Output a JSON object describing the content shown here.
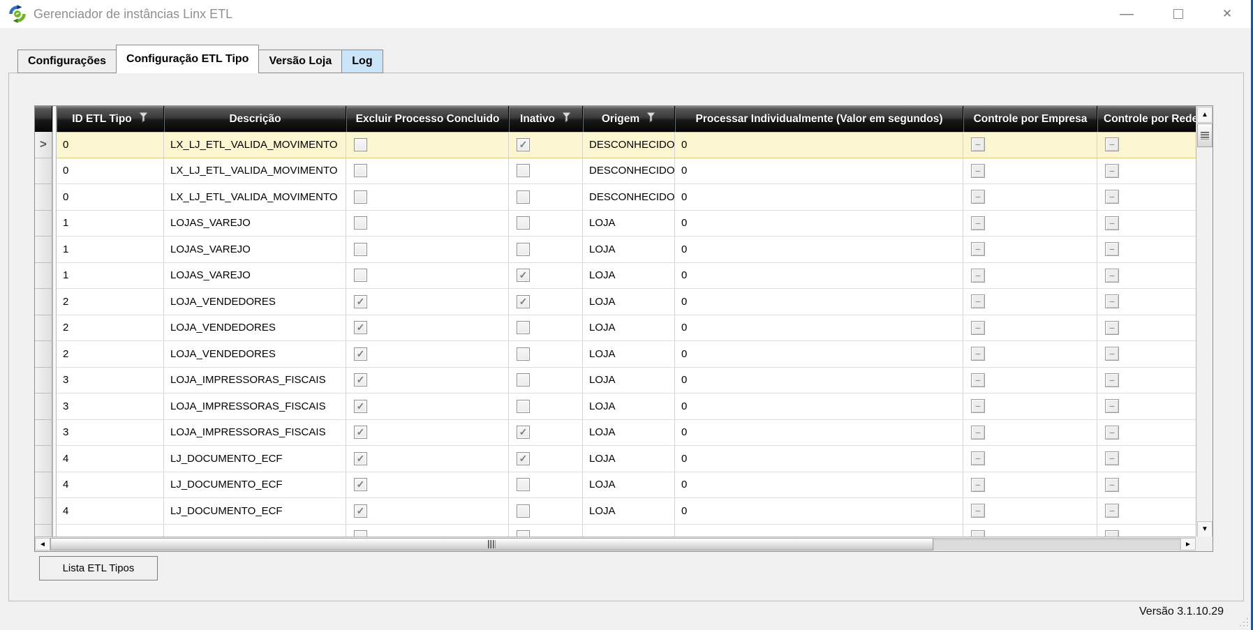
{
  "window": {
    "title": "Gerenciador de instâncias Linx ETL",
    "app_icon": "sync-arrows-icon",
    "controls": [
      {
        "name": "minimize",
        "glyph": "—"
      },
      {
        "name": "maximize",
        "glyph": ""
      },
      {
        "name": "close",
        "glyph": "✕"
      }
    ]
  },
  "tabs": [
    {
      "name": "configuracoes",
      "label": "Configurações",
      "state": "normal"
    },
    {
      "name": "configuracao-etl-tipo",
      "label": "Configuração ETL Tipo",
      "state": "active"
    },
    {
      "name": "versao-loja",
      "label": "Versão Loja",
      "state": "normal"
    },
    {
      "name": "log",
      "label": "Log",
      "state": "highlighted"
    }
  ],
  "grid": {
    "columns": [
      {
        "key": "id",
        "label": "ID ETL Tipo",
        "filter_icon": true
      },
      {
        "key": "descricao",
        "label": "Descrição",
        "filter_icon": false
      },
      {
        "key": "excluir",
        "label": "Excluir Processo Concluido",
        "filter_icon": false
      },
      {
        "key": "inativo",
        "label": "Inativo",
        "filter_icon": true
      },
      {
        "key": "origem",
        "label": "Origem",
        "filter_icon": true
      },
      {
        "key": "processar",
        "label": "Processar Individualmente (Valor em segundos)",
        "filter_icon": false
      },
      {
        "key": "controle_por_empresa",
        "label": "Controle por Empresa",
        "filter_icon": false
      },
      {
        "key": "controle_por_rede",
        "label": "Controle por Rede",
        "filter_icon": false
      }
    ],
    "current_row_indicator": ">",
    "rows": [
      {
        "id": "0",
        "descricao": "LX_LJ_ETL_VALIDA_MOVIMENTO",
        "excluir": false,
        "inativo": true,
        "origem": "DESCONHECIDO",
        "processar": "0",
        "controle_por_empresa": "indeterminate",
        "controle_por_rede": "indeterminate",
        "selected": true
      },
      {
        "id": "0",
        "descricao": "LX_LJ_ETL_VALIDA_MOVIMENTO",
        "excluir": false,
        "inativo": false,
        "origem": "DESCONHECIDO",
        "processar": "0",
        "controle_por_empresa": "indeterminate",
        "controle_por_rede": "indeterminate"
      },
      {
        "id": "0",
        "descricao": "LX_LJ_ETL_VALIDA_MOVIMENTO",
        "excluir": false,
        "inativo": false,
        "origem": "DESCONHECIDO",
        "processar": "0",
        "controle_por_empresa": "indeterminate",
        "controle_por_rede": "indeterminate"
      },
      {
        "id": "1",
        "descricao": "LOJAS_VAREJO",
        "excluir": false,
        "inativo": false,
        "origem": "LOJA",
        "processar": "0",
        "controle_por_empresa": "indeterminate",
        "controle_por_rede": "indeterminate"
      },
      {
        "id": "1",
        "descricao": "LOJAS_VAREJO",
        "excluir": false,
        "inativo": false,
        "origem": "LOJA",
        "processar": "0",
        "controle_por_empresa": "indeterminate",
        "controle_por_rede": "indeterminate"
      },
      {
        "id": "1",
        "descricao": "LOJAS_VAREJO",
        "excluir": false,
        "inativo": true,
        "origem": "LOJA",
        "processar": "0",
        "controle_por_empresa": "indeterminate",
        "controle_por_rede": "indeterminate"
      },
      {
        "id": "2",
        "descricao": "LOJA_VENDEDORES",
        "excluir": true,
        "inativo": true,
        "origem": "LOJA",
        "processar": "0",
        "controle_por_empresa": "indeterminate",
        "controle_por_rede": "indeterminate"
      },
      {
        "id": "2",
        "descricao": "LOJA_VENDEDORES",
        "excluir": true,
        "inativo": false,
        "origem": "LOJA",
        "processar": "0",
        "controle_por_empresa": "indeterminate",
        "controle_por_rede": "indeterminate"
      },
      {
        "id": "2",
        "descricao": "LOJA_VENDEDORES",
        "excluir": true,
        "inativo": false,
        "origem": "LOJA",
        "processar": "0",
        "controle_por_empresa": "indeterminate",
        "controle_por_rede": "indeterminate"
      },
      {
        "id": "3",
        "descricao": "LOJA_IMPRESSORAS_FISCAIS",
        "excluir": true,
        "inativo": false,
        "origem": "LOJA",
        "processar": "0",
        "controle_por_empresa": "indeterminate",
        "controle_por_rede": "indeterminate"
      },
      {
        "id": "3",
        "descricao": "LOJA_IMPRESSORAS_FISCAIS",
        "excluir": true,
        "inativo": false,
        "origem": "LOJA",
        "processar": "0",
        "controle_por_empresa": "indeterminate",
        "controle_por_rede": "indeterminate"
      },
      {
        "id": "3",
        "descricao": "LOJA_IMPRESSORAS_FISCAIS",
        "excluir": true,
        "inativo": true,
        "origem": "LOJA",
        "processar": "0",
        "controle_por_empresa": "indeterminate",
        "controle_por_rede": "indeterminate"
      },
      {
        "id": "4",
        "descricao": "LJ_DOCUMENTO_ECF",
        "excluir": true,
        "inativo": true,
        "origem": "LOJA",
        "processar": "0",
        "controle_por_empresa": "indeterminate",
        "controle_por_rede": "indeterminate"
      },
      {
        "id": "4",
        "descricao": "LJ_DOCUMENTO_ECF",
        "excluir": true,
        "inativo": false,
        "origem": "LOJA",
        "processar": "0",
        "controle_por_empresa": "indeterminate",
        "controle_por_rede": "indeterminate"
      },
      {
        "id": "4",
        "descricao": "LJ_DOCUMENTO_ECF",
        "excluir": true,
        "inativo": false,
        "origem": "LOJA",
        "processar": "0",
        "controle_por_empresa": "indeterminate",
        "controle_por_rede": "indeterminate"
      },
      {
        "id": "",
        "descricao": "",
        "excluir": false,
        "inativo": false,
        "origem": "",
        "processar": "",
        "controle_por_empresa": "indeterminate",
        "controle_por_rede": "indeterminate",
        "partial": true
      }
    ]
  },
  "footer": {
    "list_button_label": "Lista ETL Tipos",
    "version": "Versão 3.1.10.29"
  },
  "colors": {
    "selected_row": "#fbf5d0",
    "log_tab_highlight": "#cbe4f8",
    "header_background_dark": "#1a1a1a",
    "accent_window_edge": "#24518f"
  },
  "icons": {
    "filter": "funnel",
    "scroll_up": "▲",
    "scroll_down": "▼",
    "scroll_left": "◄",
    "scroll_right": "►",
    "check": "✓",
    "indeterminate": "−"
  }
}
